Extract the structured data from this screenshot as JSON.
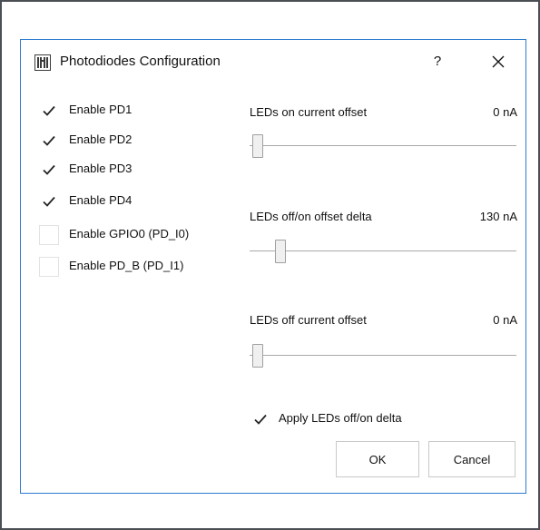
{
  "dialog": {
    "title": "Photodiodes Configuration",
    "help_label": "?",
    "icon": "app-logo-icon",
    "close_icon": "close-icon"
  },
  "checkboxes": [
    {
      "label": "Enable PD1",
      "checked": true
    },
    {
      "label": "Enable PD2",
      "checked": true
    },
    {
      "label": "Enable PD3",
      "checked": true
    },
    {
      "label": "Enable PD4",
      "checked": true
    },
    {
      "label": "Enable GPIO0 (PD_I0)",
      "checked": false
    },
    {
      "label": "Enable PD_B (PD_I1)",
      "checked": false
    }
  ],
  "sliders": [
    {
      "label": "LEDs on current offset",
      "value": "0 nA",
      "level": 0.0
    },
    {
      "label": "LEDs off/on offset delta",
      "value": "130 nA",
      "level": 0.03
    },
    {
      "label": "LEDs off current offset",
      "value": "0 nA",
      "level": 0.0
    }
  ],
  "apply_delta": {
    "label": "Apply LEDs off/on delta",
    "checked": true
  },
  "buttons": {
    "ok": "OK",
    "cancel": "Cancel"
  },
  "colors": {
    "accent_border": "#2c7bd0",
    "check_mark": "#222222"
  }
}
